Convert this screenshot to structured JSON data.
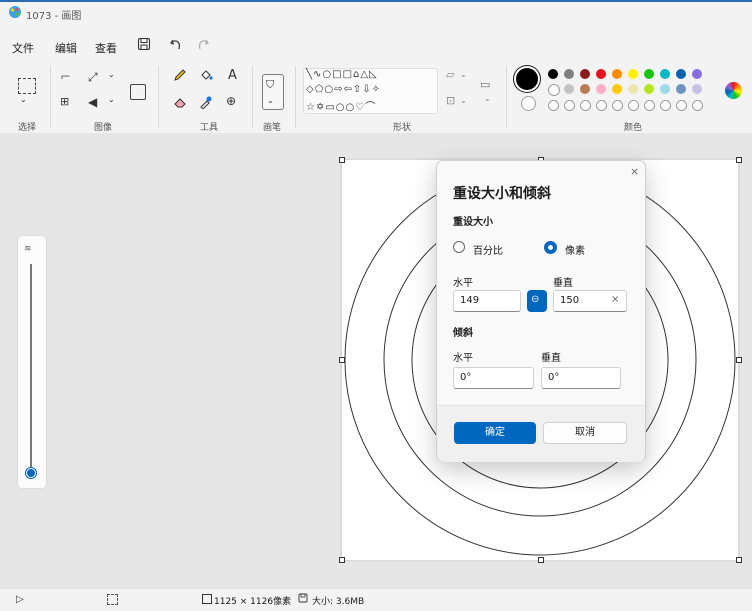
{
  "window": {
    "title": "1073 - 画图"
  },
  "menu": {
    "file": "文件",
    "edit": "编辑",
    "view": "查看"
  },
  "ribbon": {
    "select_label": "选择",
    "image_label": "图像",
    "tools_label": "工具",
    "brushes_label": "画笔",
    "shapes_label": "形状",
    "colors_label": "颜色",
    "text_tool": "A",
    "color_row1": [
      "#000000",
      "#7f7f7f",
      "#8b1a1a",
      "#e81123",
      "#ff8c00",
      "#fff100",
      "#16c60c",
      "#00b7c3",
      "#0063b1",
      "#886ce4"
    ],
    "color_row2": [
      "#ffffff",
      "#c3c3c3",
      "#b97a57",
      "#ffaec9",
      "#ffc90e",
      "#efe4b0",
      "#b5e61d",
      "#99d9ea",
      "#7092be",
      "#c8bfe7"
    ]
  },
  "dialog": {
    "title": "重设大小和倾斜",
    "resize_heading": "重设大小",
    "percent_label": "百分比",
    "pixels_label": "像素",
    "horizontal_label": "水平",
    "vertical_label": "垂直",
    "horizontal_value": "149",
    "vertical_value": "150",
    "skew_heading": "倾斜",
    "skew_horizontal_label": "水平",
    "skew_vertical_label": "垂直",
    "skew_horizontal_value": "0°",
    "skew_vertical_value": "0°",
    "ok_label": "确定",
    "cancel_label": "取消",
    "selected_unit": "pixels"
  },
  "status": {
    "dimensions": "1125 × 1126像素",
    "size": "大小: 3.6MB"
  }
}
